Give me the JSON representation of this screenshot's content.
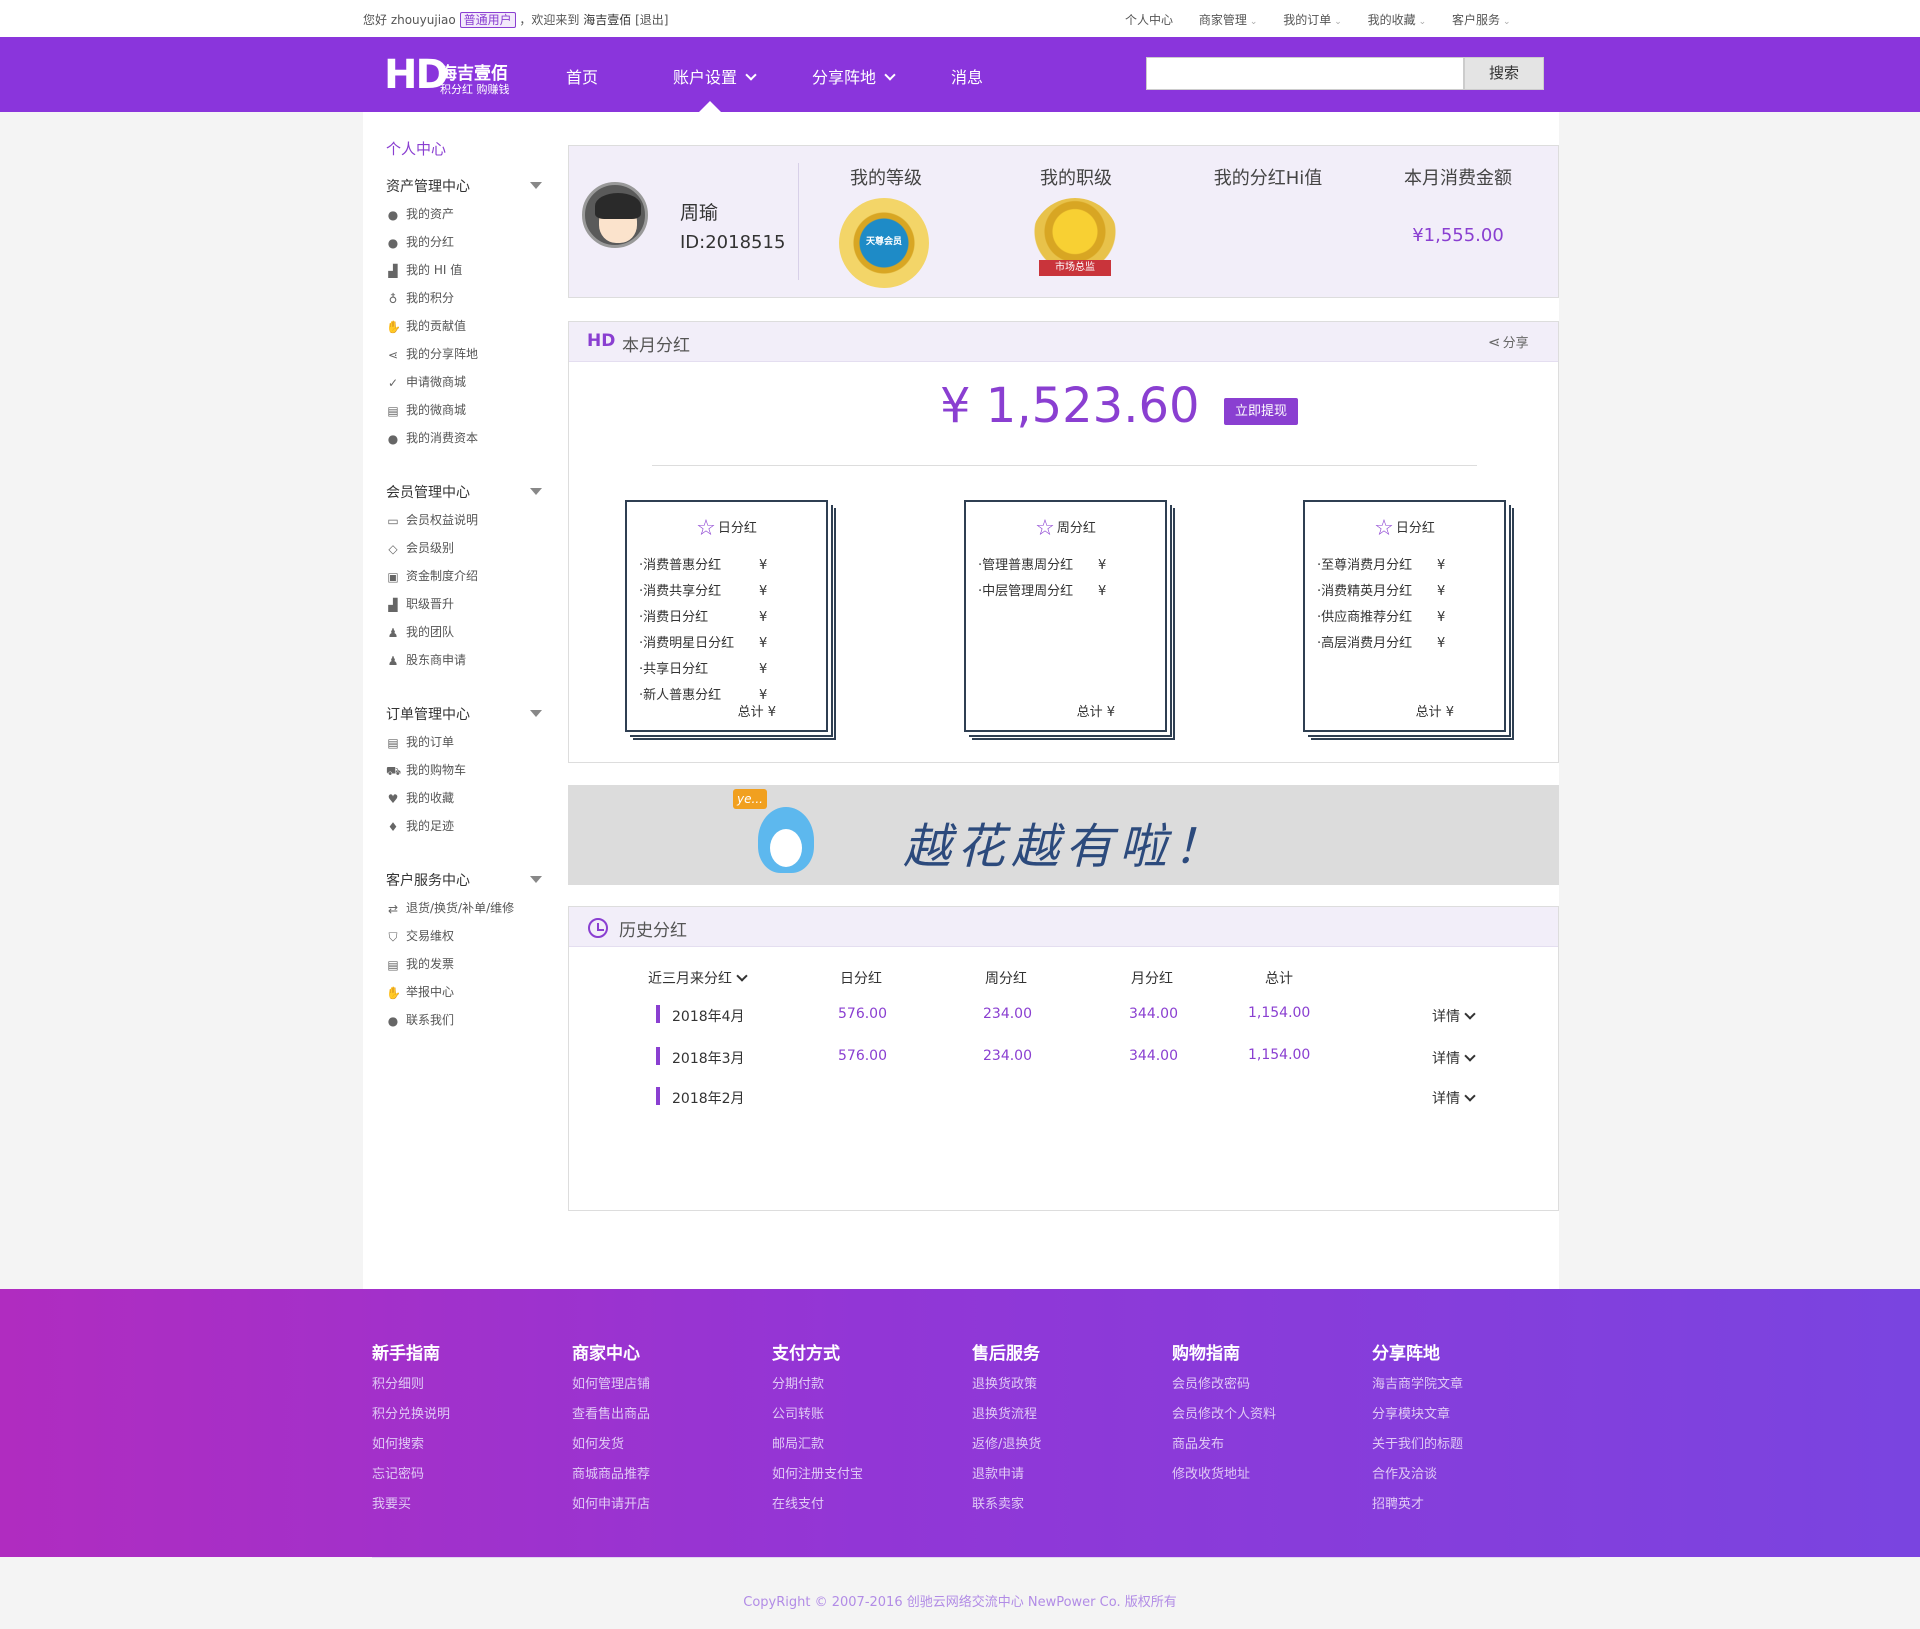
{
  "topbar": {
    "greeting_prefix": "您好 zhouyujiao",
    "user_type": "普通用户",
    "welcome": "，欢迎来到",
    "site": "海吉壹佰",
    "logout": "[退出]",
    "links": [
      "个人中心",
      "商家管理",
      "我的订单",
      "我的收藏",
      "客户服务"
    ]
  },
  "header": {
    "logo_mark": "HD",
    "logo_name": "海吉壹佰",
    "logo_slogan": "积分红 购赚钱",
    "nav": [
      "首页",
      "账户设置",
      "分享阵地",
      "消息"
    ],
    "search_button": "搜索",
    "search_placeholder": ""
  },
  "sidebar": {
    "home": "个人中心",
    "groups": [
      {
        "title": "资产管理中心",
        "items": [
          "我的资产",
          "我的分红",
          "我的 HI 值",
          "我的积分",
          "我的贡献值",
          "我的分享阵地",
          "申请微商城",
          "我的微商城",
          "我的消费资本"
        ]
      },
      {
        "title": "会员管理中心",
        "items": [
          "会员权益说明",
          "会员级别",
          "资金制度介绍",
          "职级晋升",
          "我的团队",
          "股东商申请"
        ]
      },
      {
        "title": "订单管理中心",
        "items": [
          "我的订单",
          "我的购物车",
          "我的收藏",
          "我的足迹"
        ]
      },
      {
        "title": "客户服务中心",
        "items": [
          "退货/换货/补单/维修",
          "交易维权",
          "我的发票",
          "举报中心",
          "联系我们"
        ]
      }
    ]
  },
  "profile": {
    "name": "周瑜",
    "id": "ID:2018515",
    "labels": [
      "我的等级",
      "我的职级",
      "我的分红Hi值",
      "本月消费金额"
    ],
    "level_badge": "天尊会员",
    "rank_badge": "市场总监",
    "month_amount": "¥1,555.00"
  },
  "month_dividend": {
    "title": "本月分红",
    "share": "分享",
    "amount": "¥ 1,523.60",
    "withdraw": "立即提现",
    "cards": [
      {
        "title": "日分红",
        "rows": [
          "·消费普惠分红",
          "·消费共享分红",
          "·消费日分红",
          "·消费明星日分红",
          "·共享日分红",
          "·新人普惠分红"
        ],
        "total": "总计 ¥"
      },
      {
        "title": "周分红",
        "rows": [
          "·管理普惠周分红",
          "·中层管理周分红"
        ],
        "total": "总计 ¥"
      },
      {
        "title": "日分红",
        "rows": [
          "·至尊消费月分红",
          "·消费精英月分红",
          "·供应商推荐分红",
          "·高层消费月分红"
        ],
        "total": "总计 ¥"
      }
    ],
    "yen": "¥"
  },
  "banner": {
    "bubble": "ye...",
    "text": "越花越有啦！"
  },
  "history": {
    "title": "历史分红",
    "headers": [
      "近三月来分红",
      "日分红",
      "周分红",
      "月分红",
      "总计"
    ],
    "detail": "详情",
    "rows": [
      {
        "month": "2018年4月",
        "day": "576.00",
        "week": "234.00",
        "monthly": "344.00",
        "total": "1,154.00"
      },
      {
        "month": "2018年3月",
        "day": "576.00",
        "week": "234.00",
        "monthly": "344.00",
        "total": "1,154.00"
      },
      {
        "month": "2018年2月",
        "day": "",
        "week": "",
        "monthly": "",
        "total": ""
      }
    ]
  },
  "footer": {
    "columns": [
      {
        "title": "新手指南",
        "links": [
          "积分细则",
          "积分兑换说明",
          "如何搜索",
          "忘记密码",
          "我要买"
        ]
      },
      {
        "title": "商家中心",
        "links": [
          "如何管理店铺",
          "查看售出商品",
          "如何发货",
          "商城商品推荐",
          "如何申请开店"
        ]
      },
      {
        "title": "支付方式",
        "links": [
          "分期付款",
          "公司转账",
          "邮局汇款",
          "如何注册支付宝",
          "在线支付"
        ]
      },
      {
        "title": "售后服务",
        "links": [
          "退换货政策",
          "退换货流程",
          "返修/退换货",
          "退款申请",
          "联系卖家"
        ]
      },
      {
        "title": "购物指南",
        "links": [
          "会员修改密码",
          "会员修改个人资料",
          "商品发布",
          "修改收货地址"
        ]
      },
      {
        "title": "分享阵地",
        "links": [
          "海吉商学院文章",
          "分享模块文章",
          "关于我们的标题",
          "合作及洽谈",
          "招聘英才"
        ]
      }
    ],
    "copyright": "CopyRight © 2007-2016 创驰云网络交流中心 NewPower Co. 版权所有"
  },
  "colors": {
    "accent": "#8a3fd1",
    "header": "#8a35dc",
    "panel_tint": "#f2eef9"
  }
}
